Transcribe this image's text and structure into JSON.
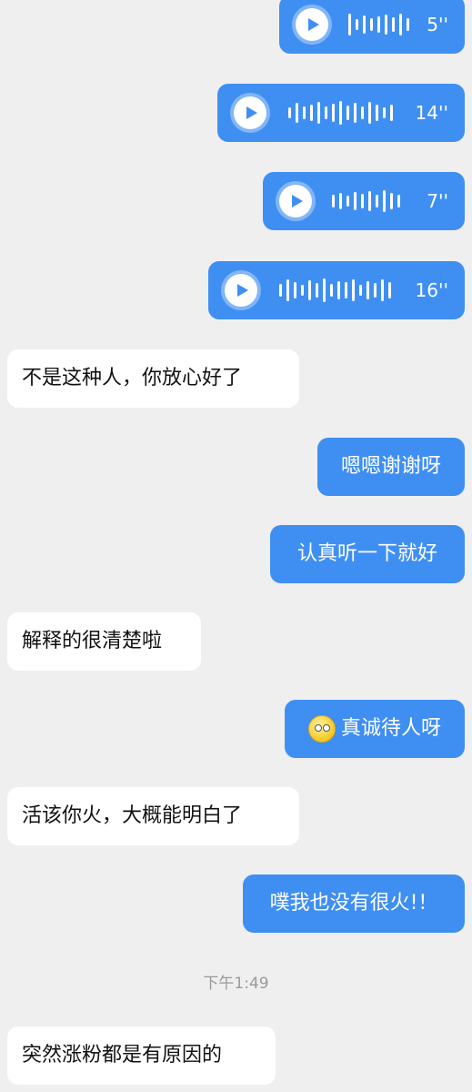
{
  "colors": {
    "background": "#efefef",
    "outgoing": "#3f8ff2",
    "incoming": "#ffffff"
  },
  "voice_messages": [
    {
      "duration": "5''"
    },
    {
      "duration": "14''"
    },
    {
      "duration": "7''"
    },
    {
      "duration": "16''"
    }
  ],
  "messages": [
    {
      "side": "left",
      "text": "不是这种人，你放心好了"
    },
    {
      "side": "right",
      "text": "嗯嗯谢谢呀"
    },
    {
      "side": "right",
      "text": "认真听一下就好"
    },
    {
      "side": "left",
      "text": "解释的很清楚啦"
    },
    {
      "side": "right",
      "text": "真诚待人呀",
      "icon": "rolling-eyes-emoji-icon"
    },
    {
      "side": "left",
      "text": "活该你火，大概能明白了"
    },
    {
      "side": "right",
      "text": "噗我也没有很火!！"
    },
    {
      "side": "left",
      "text": "突然涨粉都是有原因的"
    }
  ],
  "timestamp": "下午1:49"
}
